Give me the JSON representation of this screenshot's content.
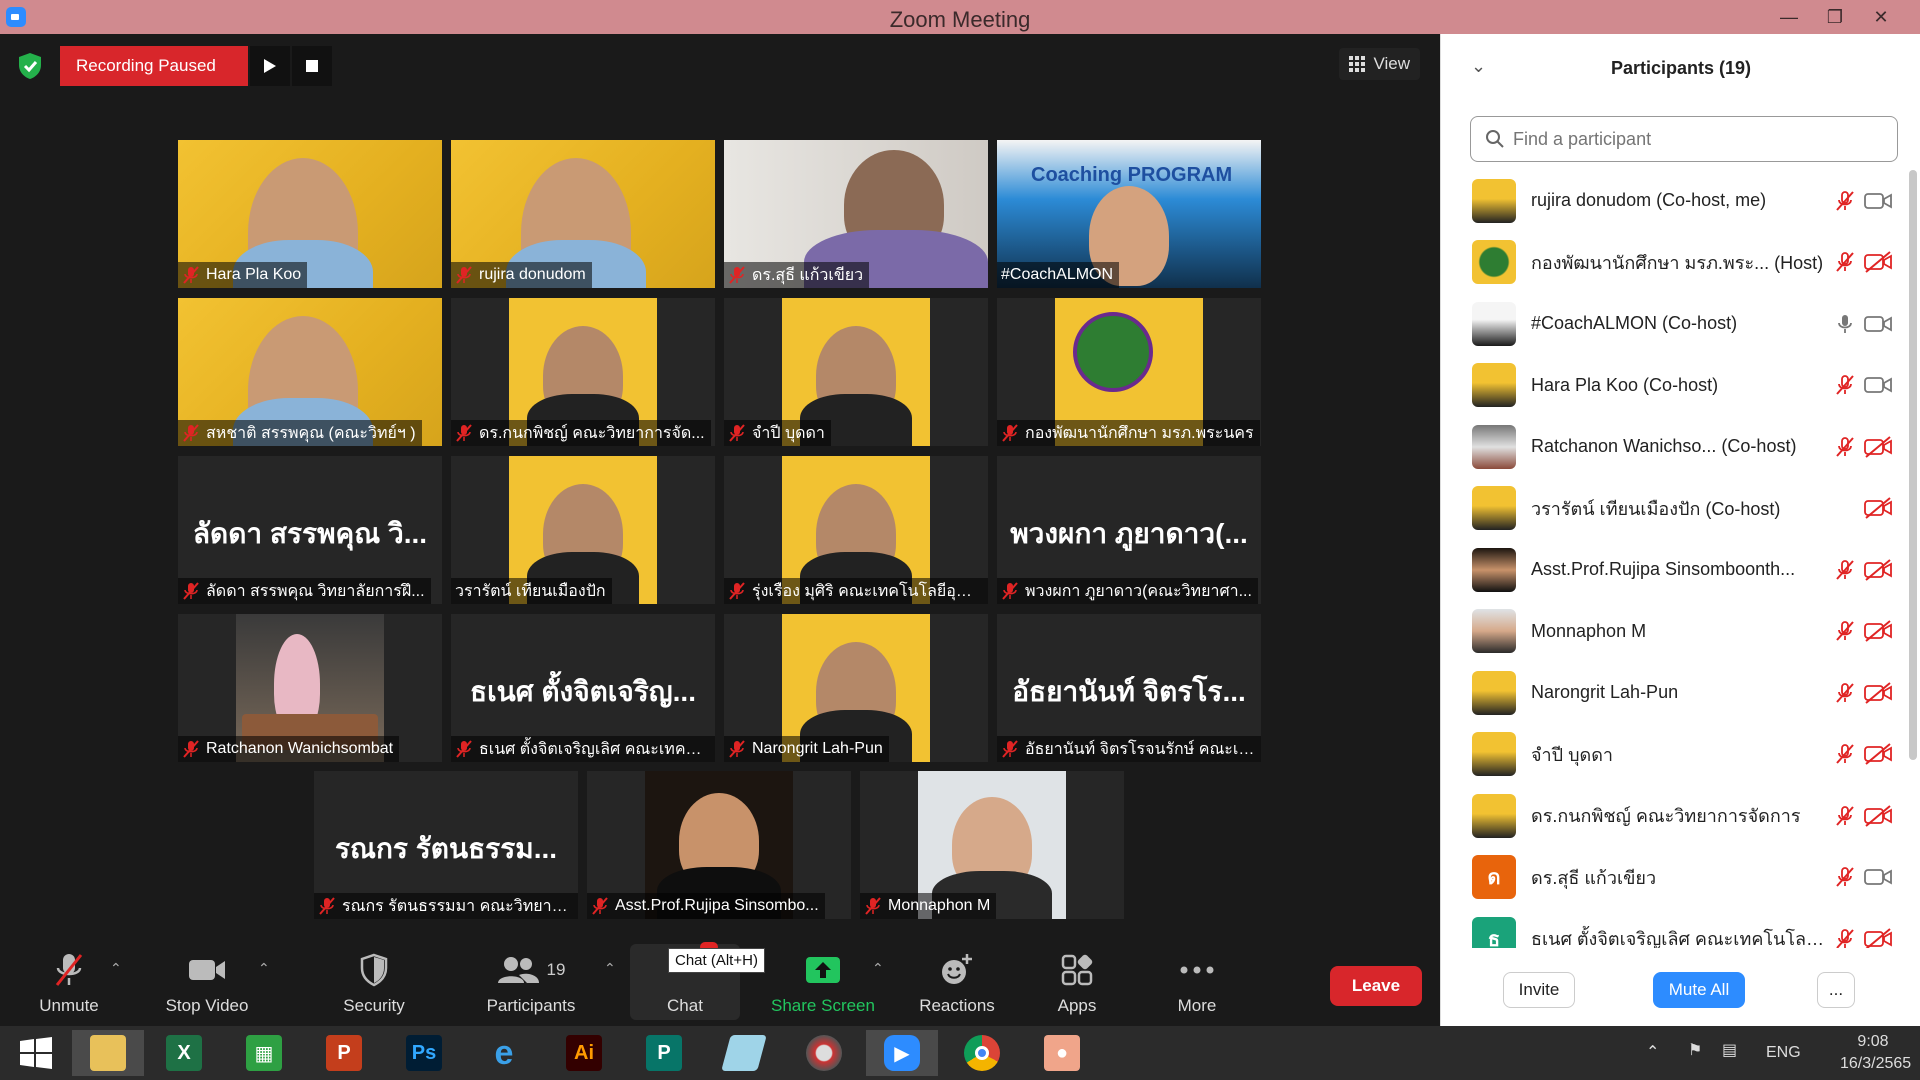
{
  "window": {
    "title": "Zoom Meeting"
  },
  "recording": {
    "label": "Recording Paused"
  },
  "view": {
    "label": "View"
  },
  "tiles": [
    {
      "name": "Hara Pla Koo",
      "kind": "yellow"
    },
    {
      "name": "rujira donudom",
      "kind": "yellow"
    },
    {
      "name": "ดร.สุธี  แก้วเขียว",
      "kind": "purple"
    },
    {
      "name": "#CoachALMON",
      "kind": "coach",
      "banner": "Coaching PROGRAM"
    },
    {
      "name": "สหชาติ สรรพคุณ (คณะวิทย์ฯ )",
      "kind": "yellow"
    },
    {
      "name": "ดร.กนกพิชญ์ คณะวิทยาการจัด...",
      "kind": "narrow"
    },
    {
      "name": "จำปี บุดดา",
      "kind": "narrow"
    },
    {
      "name": "กองพัฒนานักศึกษา มรภ.พระนคร",
      "kind": "logo"
    },
    {
      "name": "ลัดดา สรรพคุณ วิทยาลัยการฝึ...",
      "kind": "text",
      "big": "ลัดดา สรรพคุณ วิ..."
    },
    {
      "name": "วรารัตน์ เทียนเมืองปัก",
      "kind": "narrow"
    },
    {
      "name": "รุ่งเรือง มุศิริ คณะเทคโนโลยีอุตส...",
      "kind": "narrow"
    },
    {
      "name": "พวงผกา ภูยาดาว(คณะวิทยาศา...",
      "kind": "text",
      "big": "พวงผกา ภูยาดาว(..."
    },
    {
      "name": "Ratchanon Wanichsombat",
      "kind": "restaurant"
    },
    {
      "name": "ธเนศ ตั้งจิตเจริญเลิศ คณะเทคโน...",
      "kind": "text",
      "big": "ธเนศ ตั้งจิตเจริญ..."
    },
    {
      "name": "Narongrit Lah-Pun",
      "kind": "narrow"
    },
    {
      "name": "อัธยานันท์ จิตรโรจนรักษ์ คณะเท...",
      "kind": "text",
      "big": "อัธยานันท์ จิตรโร..."
    },
    {
      "name": "รณกร รัตนธรรมมา คณะวิทยาศ...",
      "kind": "text",
      "big": "รณกร รัตนธรรม..."
    },
    {
      "name": "Asst.Prof.Rujipa Sinsombo...",
      "kind": "dark"
    },
    {
      "name": "Monnaphon M",
      "kind": "light"
    }
  ],
  "toolbar": {
    "unmute": "Unmute",
    "stop_video": "Stop Video",
    "security": "Security",
    "participants": "Participants",
    "participants_count": "19",
    "chat": "Chat",
    "chat_tooltip": "Chat (Alt+H)",
    "share_screen": "Share Screen",
    "reactions": "Reactions",
    "apps": "Apps",
    "more": "More",
    "leave": "Leave"
  },
  "panel": {
    "title": "Participants (19)",
    "search_placeholder": "Find a participant",
    "participants": [
      {
        "name": "rujira donudom (Co-host, me)",
        "mic": "off",
        "cam": "on",
        "avatar": "photo-yellow"
      },
      {
        "name": "กองพัฒนานักศึกษา มรภ.พระ... (Host)",
        "mic": "off",
        "cam": "off",
        "avatar": "logo"
      },
      {
        "name": "#CoachALMON (Co-host)",
        "mic": "on",
        "cam": "on",
        "avatar": "photo-white"
      },
      {
        "name": "Hara Pla Koo (Co-host)",
        "mic": "off",
        "cam": "on",
        "avatar": "photo-yellow"
      },
      {
        "name": "Ratchanon Wanichso...  (Co-host)",
        "mic": "off",
        "cam": "off",
        "avatar": "photo-mixed"
      },
      {
        "name": "วรารัตน์ เทียนเมืองปัก (Co-host)",
        "mic": "none",
        "cam": "off",
        "avatar": "photo-yellow"
      },
      {
        "name": "Asst.Prof.Rujipa Sinsomboonth...",
        "mic": "off",
        "cam": "off",
        "avatar": "photo-dark"
      },
      {
        "name": "Monnaphon M",
        "mic": "off",
        "cam": "off",
        "avatar": "photo-light"
      },
      {
        "name": "Narongrit Lah-Pun",
        "mic": "off",
        "cam": "off",
        "avatar": "photo-yellow"
      },
      {
        "name": "จำปี บุดดา",
        "mic": "off",
        "cam": "off",
        "avatar": "photo-yellow"
      },
      {
        "name": "ดร.กนกพิชญ์ คณะวิทยาการจัดการ",
        "mic": "off",
        "cam": "off",
        "avatar": "photo-yellow"
      },
      {
        "name": "ดร.สุธี  แก้วเขียว",
        "mic": "off",
        "cam": "on",
        "avatar": "letter",
        "letter": "ด",
        "color": "#e8640c"
      },
      {
        "name": "ธเนศ ตั้งจิตเจริญเลิศ คณะเทคโนโลยีอุ...",
        "mic": "off",
        "cam": "off",
        "avatar": "letter",
        "letter": "ธ",
        "color": "#1aa37a"
      }
    ],
    "invite": "Invite",
    "mute_all": "Mute All",
    "more": "..."
  },
  "taskbar": {
    "apps": [
      "start",
      "file-explorer",
      "excel",
      "project-green",
      "powerpoint",
      "photoshop",
      "internet-explorer",
      "illustrator",
      "publisher",
      "notepad",
      "photoscape",
      "zoom",
      "chrome",
      "photos"
    ],
    "language": "ENG",
    "time": "9:08",
    "date": "16/3/2565"
  },
  "colors": {
    "accent_red": "#d8262b",
    "accent_blue": "#2d8cff",
    "share_green": "#22c55e",
    "highlight_yellow": "#e9ee3a"
  }
}
